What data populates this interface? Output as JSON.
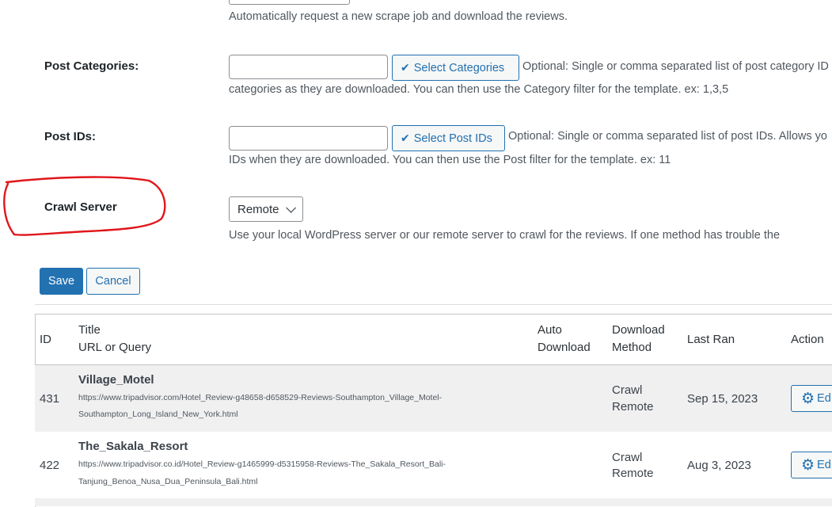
{
  "auto_download": {
    "description": "Automatically request a new scrape job and download the reviews."
  },
  "post_categories": {
    "label": "Post Categories:",
    "input_value": "",
    "button_label": "Select Categories",
    "help_line1": "Optional: Single or comma separated list of post category ID",
    "help_line2": "categories as they are downloaded. You can then use the Category filter for the template. ex: 1,3,5"
  },
  "post_ids": {
    "label": "Post IDs:",
    "input_value": "",
    "button_label": "Select Post IDs",
    "help_line1": "Optional: Single or comma separated list of post IDs. Allows yo",
    "help_line2": "IDs when they are downloaded. You can then use the Post filter for the template. ex: 11"
  },
  "crawl_server": {
    "label": "Crawl Server",
    "selected": "Remote",
    "description": "Use your local WordPress server or our remote server to crawl for the reviews. If one method has trouble the"
  },
  "actions": {
    "save_label": "Save",
    "cancel_label": "Cancel"
  },
  "table": {
    "headers": {
      "id": "ID",
      "title": "Title",
      "url": "URL or Query",
      "auto_line1": "Auto",
      "auto_line2": "Download",
      "method_line1": "Download",
      "method_line2": "Method",
      "last_ran": "Last Ran",
      "action": "Action"
    },
    "rows": [
      {
        "id": "431",
        "title": "Village_Motel",
        "url_line1": "https://www.tripadvisor.com/Hotel_Review-g48658-d658529-Reviews-Southampton_Village_Motel-",
        "url_line2": "Southampton_Long_Island_New_York.html",
        "method_line1": "Crawl",
        "method_line2": "Remote",
        "last_ran": "Sep 15, 2023",
        "action_label": "Ed"
      },
      {
        "id": "422",
        "title": "The_Sakala_Resort",
        "url_line1": "https://www.tripadvisor.co.id/Hotel_Review-g1465999-d5315958-Reviews-The_Sakala_Resort_Bali-",
        "url_line2": "Tanjung_Benoa_Nusa_Dua_Peninsula_Bali.html",
        "method_line1": "Crawl",
        "method_line2": "Remote",
        "last_ran": "Aug 3, 2023",
        "action_label": "Ed"
      }
    ]
  },
  "colors": {
    "accent": "#2271b1",
    "annotation": "#e0161b",
    "row_alt": "#f0f0f1"
  }
}
